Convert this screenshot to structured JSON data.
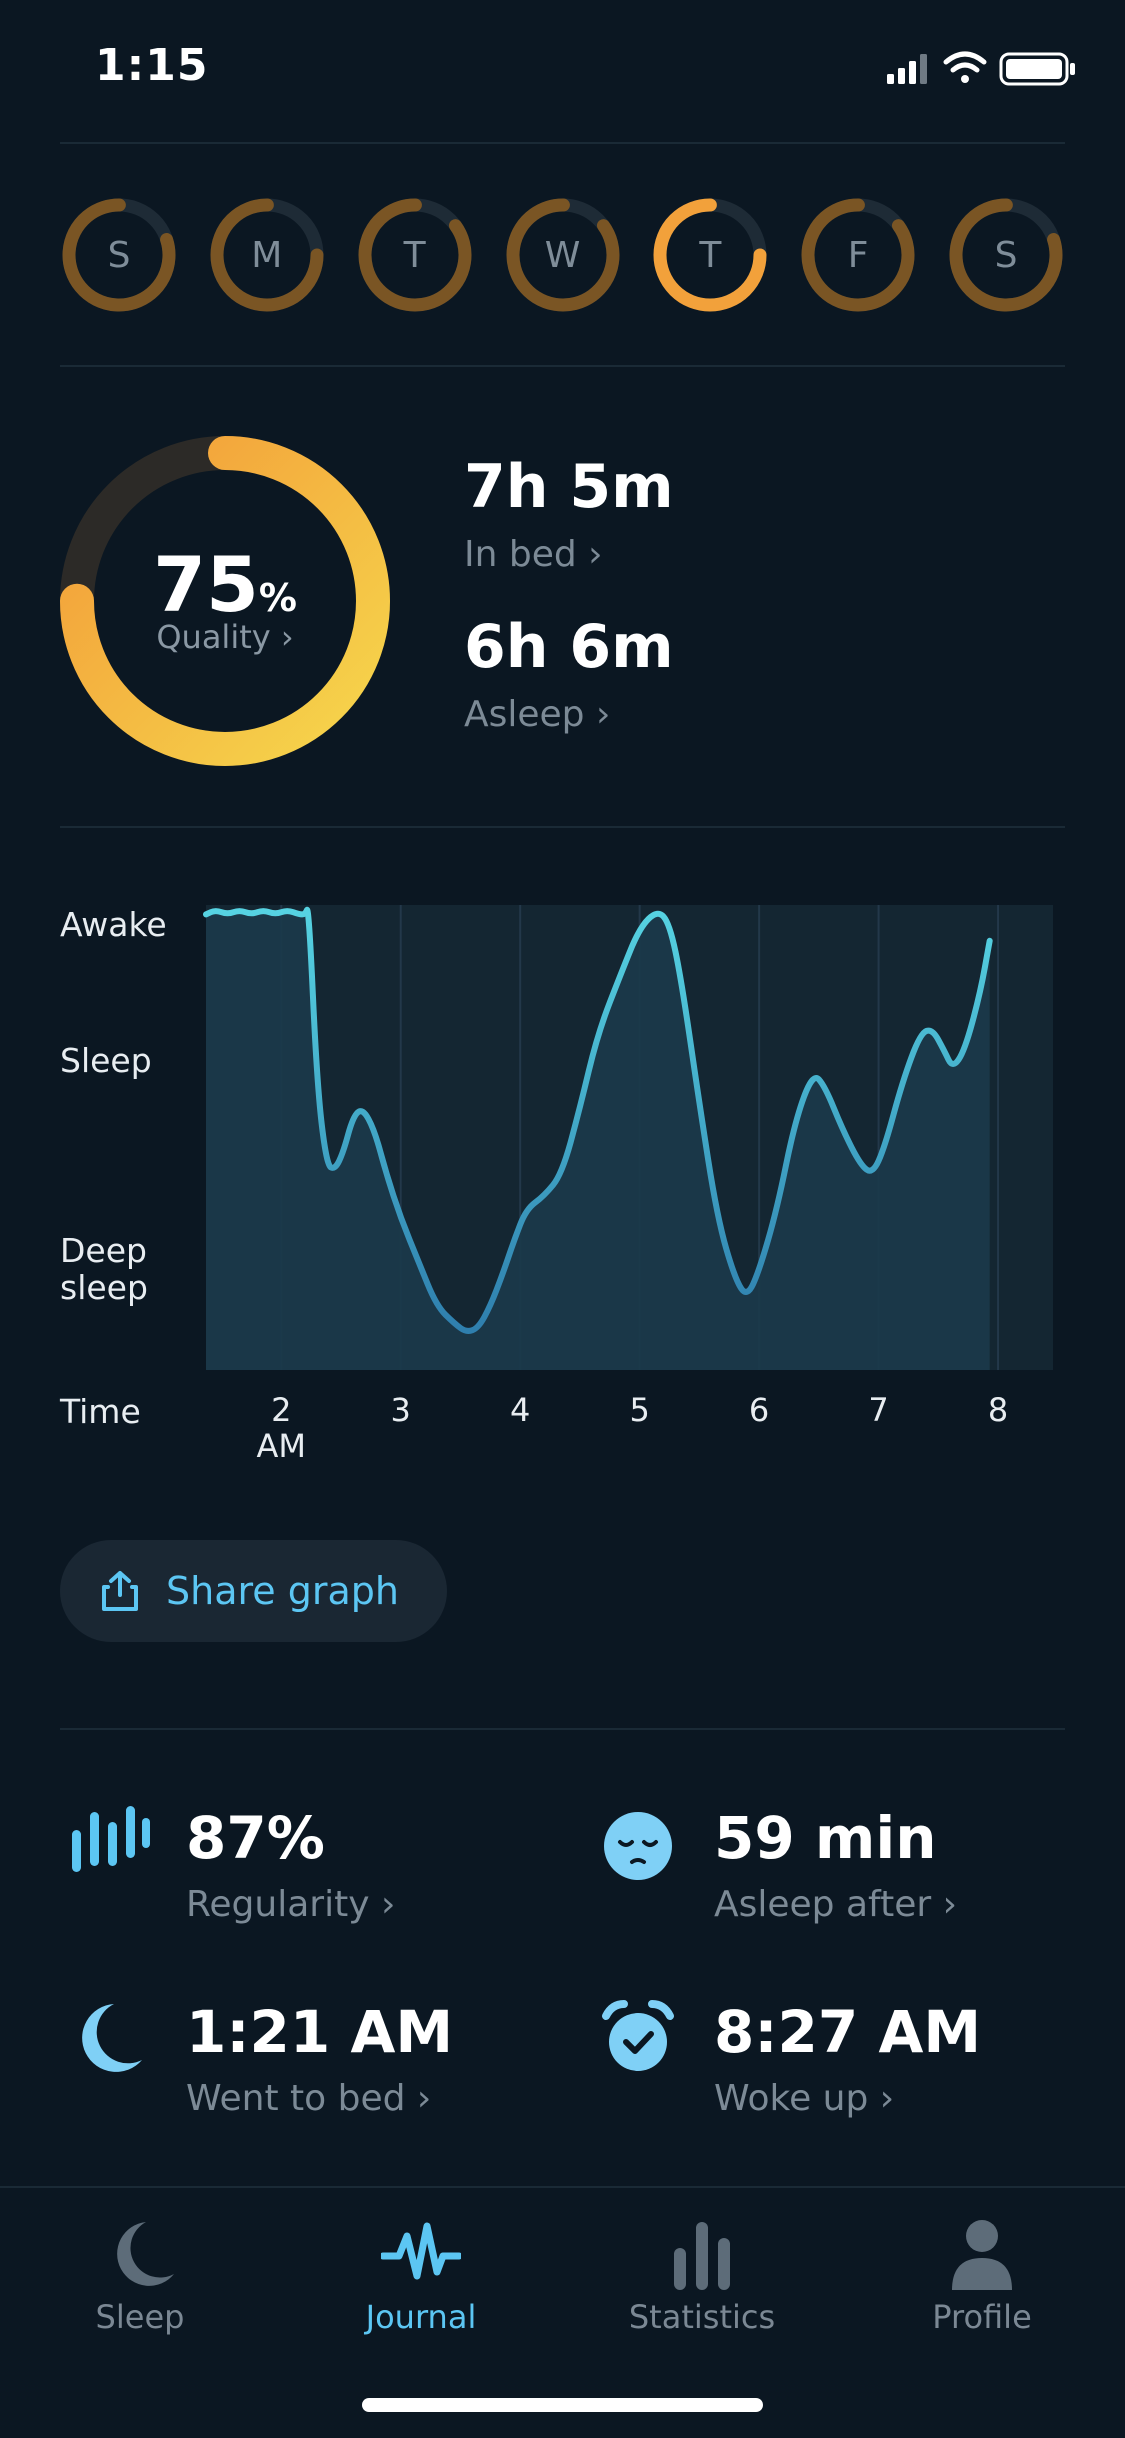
{
  "status": {
    "time": "1:15"
  },
  "week": {
    "days": [
      {
        "label": "S",
        "ring_fraction": 0.8,
        "selected": false
      },
      {
        "label": "M",
        "ring_fraction": 0.75,
        "selected": false
      },
      {
        "label": "T",
        "ring_fraction": 0.85,
        "selected": false
      },
      {
        "label": "W",
        "ring_fraction": 0.85,
        "selected": false
      },
      {
        "label": "T",
        "ring_fraction": 0.75,
        "selected": true
      },
      {
        "label": "F",
        "ring_fraction": 0.85,
        "selected": false
      },
      {
        "label": "S",
        "ring_fraction": 0.8,
        "selected": false
      }
    ]
  },
  "summary": {
    "quality_value": "75",
    "quality_unit": "%",
    "quality_label": "Quality ›",
    "quality_fraction": 0.75,
    "in_bed_value": "7h 5m",
    "in_bed_label": "In bed ›",
    "asleep_value": "6h 6m",
    "asleep_label": "Asleep ›"
  },
  "graph": {
    "y_labels": {
      "awake": "Awake",
      "sleep": "Sleep",
      "deep_line1": "Deep",
      "deep_line2": "sleep"
    },
    "x_axis_title": "Time",
    "x_ticks": [
      {
        "label": "2",
        "sub": "AM",
        "hour": 2
      },
      {
        "label": "3",
        "sub": "",
        "hour": 3
      },
      {
        "label": "4",
        "sub": "",
        "hour": 4
      },
      {
        "label": "5",
        "sub": "",
        "hour": 5
      },
      {
        "label": "6",
        "sub": "",
        "hour": 6
      },
      {
        "label": "7",
        "sub": "",
        "hour": 7
      },
      {
        "label": "8",
        "sub": "",
        "hour": 8
      }
    ]
  },
  "chart_data": {
    "type": "area",
    "x_unit": "hour",
    "y_scale": "Deep sleep (0) to Awake (1)",
    "xlim": [
      1.37,
      8.46
    ],
    "ylim": [
      0,
      1
    ],
    "points": [
      [
        1.37,
        0.99
      ],
      [
        1.45,
        1.0
      ],
      [
        1.55,
        0.99
      ],
      [
        1.65,
        1.0
      ],
      [
        1.75,
        0.99
      ],
      [
        1.85,
        1.0
      ],
      [
        1.95,
        0.99
      ],
      [
        2.05,
        1.0
      ],
      [
        2.15,
        0.99
      ],
      [
        2.2,
        0.99
      ],
      [
        2.23,
        1.01
      ],
      [
        2.3,
        0.6
      ],
      [
        2.38,
        0.42
      ],
      [
        2.45,
        0.41
      ],
      [
        2.52,
        0.45
      ],
      [
        2.6,
        0.53
      ],
      [
        2.68,
        0.55
      ],
      [
        2.78,
        0.5
      ],
      [
        2.88,
        0.4
      ],
      [
        3.0,
        0.3
      ],
      [
        3.15,
        0.2
      ],
      [
        3.3,
        0.1
      ],
      [
        3.45,
        0.06
      ],
      [
        3.55,
        0.04
      ],
      [
        3.65,
        0.05
      ],
      [
        3.75,
        0.1
      ],
      [
        3.85,
        0.17
      ],
      [
        3.95,
        0.25
      ],
      [
        4.05,
        0.32
      ],
      [
        4.2,
        0.35
      ],
      [
        4.35,
        0.4
      ],
      [
        4.5,
        0.55
      ],
      [
        4.65,
        0.72
      ],
      [
        4.85,
        0.86
      ],
      [
        5.0,
        0.96
      ],
      [
        5.15,
        1.0
      ],
      [
        5.25,
        0.97
      ],
      [
        5.35,
        0.84
      ],
      [
        5.5,
        0.56
      ],
      [
        5.65,
        0.3
      ],
      [
        5.8,
        0.16
      ],
      [
        5.9,
        0.12
      ],
      [
        6.0,
        0.18
      ],
      [
        6.15,
        0.32
      ],
      [
        6.3,
        0.52
      ],
      [
        6.45,
        0.63
      ],
      [
        6.55,
        0.6
      ],
      [
        6.7,
        0.5
      ],
      [
        6.85,
        0.42
      ],
      [
        6.95,
        0.4
      ],
      [
        7.05,
        0.46
      ],
      [
        7.2,
        0.61
      ],
      [
        7.35,
        0.72
      ],
      [
        7.45,
        0.73
      ],
      [
        7.55,
        0.68
      ],
      [
        7.62,
        0.64
      ],
      [
        7.72,
        0.68
      ],
      [
        7.85,
        0.81
      ],
      [
        7.93,
        0.93
      ]
    ]
  },
  "share": {
    "label": "Share graph"
  },
  "metrics": {
    "regularity_value": "87%",
    "regularity_label": "Regularity ›",
    "asleep_after_value": "59 min",
    "asleep_after_label": "Asleep after ›",
    "bed_value": "1:21 AM",
    "bed_label": "Went to bed ›",
    "woke_value": "8:27 AM",
    "woke_label": "Woke up ›"
  },
  "tabs": [
    {
      "label": "Sleep",
      "icon": "moon-icon",
      "active": false
    },
    {
      "label": "Journal",
      "icon": "waveform-icon",
      "active": true
    },
    {
      "label": "Statistics",
      "icon": "bars-icon",
      "active": false
    },
    {
      "label": "Profile",
      "icon": "person-icon",
      "active": false
    }
  ],
  "colors": {
    "accent": "#5cc6f3",
    "ring_orange": "#f2a13b",
    "ring_yellow": "#f6d24a",
    "line": "#4fc6e0",
    "bg": "#0b1722"
  }
}
